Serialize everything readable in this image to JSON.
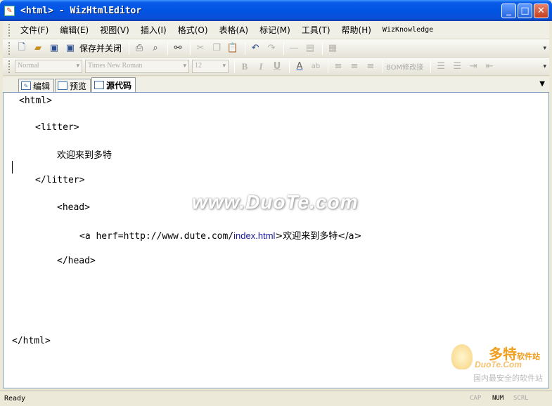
{
  "window": {
    "title": "<html> - WizHtmlEditor",
    "minimize": "_",
    "maximize": "□",
    "close": "✕"
  },
  "menu": [
    "文件(F)",
    "编辑(E)",
    "视图(V)",
    "插入(I)",
    "格式(O)",
    "表格(A)",
    "标记(M)",
    "工具(T)",
    "帮助(H)",
    "WizKnowledge"
  ],
  "toolbar1": {
    "save_close_label": "保存并关闭",
    "icons": [
      "new-file-icon",
      "open-folder-icon",
      "save-icon",
      "save-close-icon",
      "print-icon",
      "print-preview-icon",
      "find-icon",
      "cut-icon",
      "copy-icon",
      "paste-icon",
      "undo-icon",
      "redo-icon",
      "horizontal-rule-icon",
      "insert-icon",
      "table-icon"
    ]
  },
  "toolbar2": {
    "style_select": "Normal",
    "font_select": "Times New Roman",
    "size_select": "12",
    "bold": "B",
    "italic": "I",
    "underline": "U",
    "font_color": "A",
    "highlight": "ab",
    "clear_format_label": "BOM修改接"
  },
  "tabs": [
    {
      "label": "编辑",
      "active": false
    },
    {
      "label": "预览",
      "active": false
    },
    {
      "label": "源代码",
      "active": true
    }
  ],
  "code": {
    "line1": "<html>",
    "line2": "<litter>",
    "line3": "欢迎来到多特",
    "line4": "</litter>",
    "line5": "<head>",
    "line6_tag": "<a  herf=http://www.dute.com/",
    "line6_url": "index.html",
    "line6_text": ">欢迎来到多特</a>",
    "line7": "</head>",
    "line8": "</html>"
  },
  "watermark": "www.DuoTe.com",
  "brand": {
    "name_cn": "多特",
    "name_suffix": "软件站",
    "name_en": "DuoTe.Com",
    "tagline": "国内最安全的软件站"
  },
  "status": {
    "text": "Ready",
    "cap": "CAP",
    "num": "NUM",
    "scrl": "SCRL"
  },
  "colors": {
    "titlebar": "#0054e3",
    "background": "#ece9d8",
    "brand_orange": "#f0a020"
  }
}
